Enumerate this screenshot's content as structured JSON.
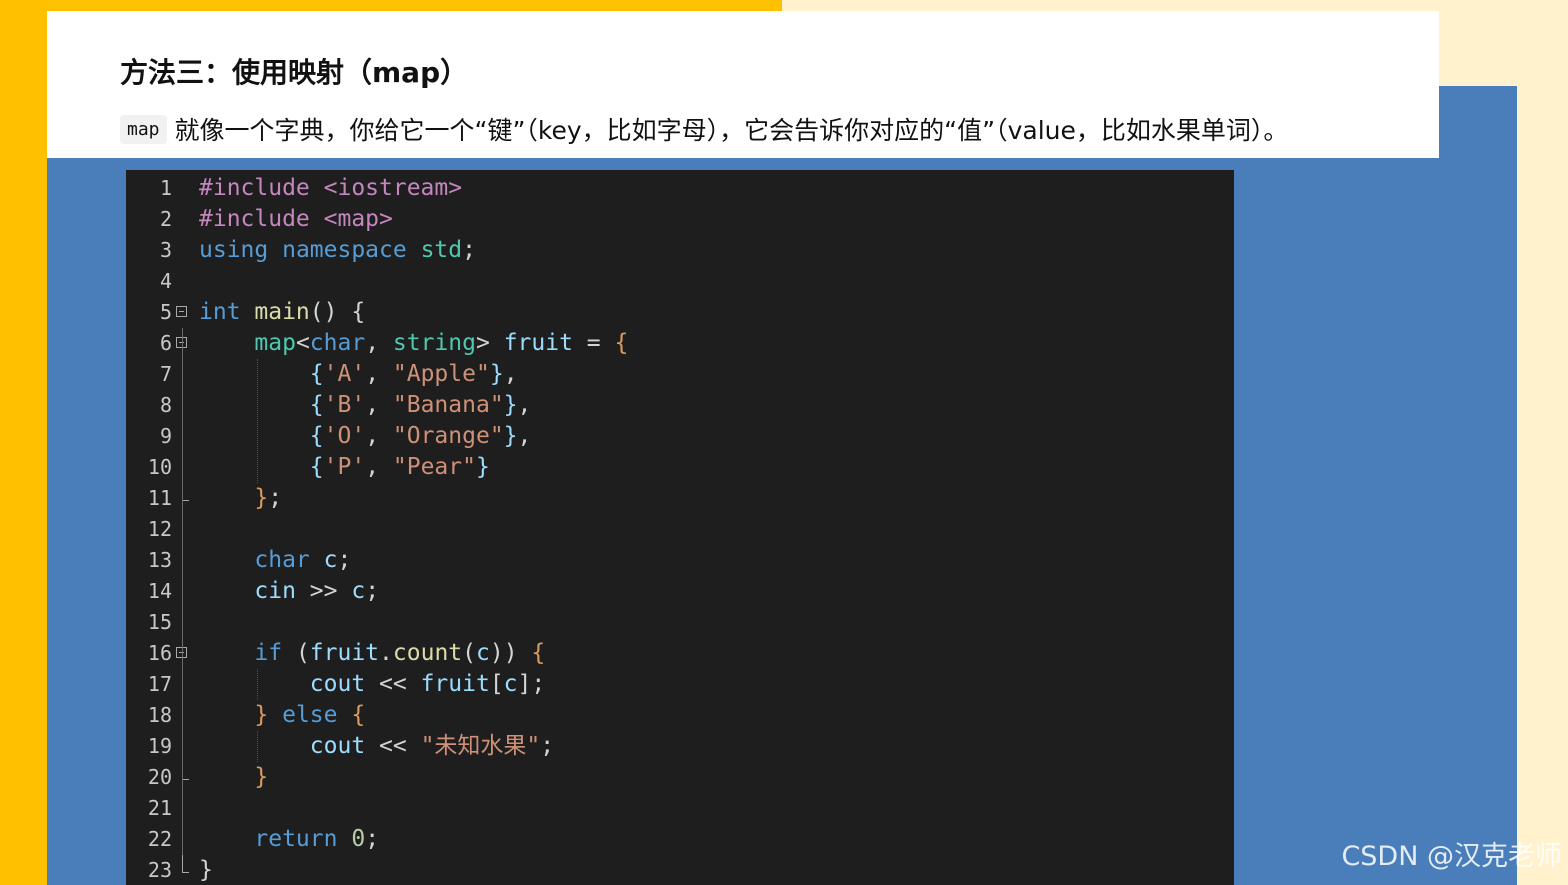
{
  "slide": {
    "heading": "方法三：使用映射（map）",
    "inline_code": "map",
    "description": "就像一个字典，你给它一个“键”（key，比如字母），它会告诉你对应的“值”（value，比如水果单词）。"
  },
  "code": {
    "language": "cpp",
    "lines": [
      {
        "n": "1",
        "fold": "",
        "tokens": [
          [
            "dir",
            "#include <iostream>"
          ]
        ]
      },
      {
        "n": "2",
        "fold": "",
        "tokens": [
          [
            "dir",
            "#include <map>"
          ]
        ]
      },
      {
        "n": "3",
        "fold": "",
        "tokens": [
          [
            "kw",
            "using "
          ],
          [
            "kw",
            "namespace "
          ],
          [
            "type",
            "std"
          ],
          [
            "pun",
            ";"
          ]
        ]
      },
      {
        "n": "4",
        "fold": "",
        "tokens": []
      },
      {
        "n": "5",
        "fold": "open",
        "tokens": [
          [
            "kw",
            "int "
          ],
          [
            "fn",
            "main"
          ],
          [
            "pun",
            "() "
          ],
          [
            "pun",
            "{"
          ]
        ]
      },
      {
        "n": "6",
        "fold": "open",
        "tokens": [
          [
            "pun",
            "    "
          ],
          [
            "type",
            "map"
          ],
          [
            "pun",
            "<"
          ],
          [
            "kw",
            "char"
          ],
          [
            "pun",
            ", "
          ],
          [
            "type",
            "string"
          ],
          [
            "pun",
            "> "
          ],
          [
            "var",
            "fruit"
          ],
          [
            "pun",
            " = "
          ],
          [
            "brc",
            "{"
          ]
        ]
      },
      {
        "n": "7",
        "fold": "",
        "tokens": [
          [
            "pun",
            "        "
          ],
          [
            "var",
            "{"
          ],
          [
            "str",
            "'A'"
          ],
          [
            "pun",
            ", "
          ],
          [
            "str",
            "\"Apple\""
          ],
          [
            "var",
            "}"
          ],
          [
            "pun",
            ","
          ]
        ]
      },
      {
        "n": "8",
        "fold": "",
        "tokens": [
          [
            "pun",
            "        "
          ],
          [
            "var",
            "{"
          ],
          [
            "str",
            "'B'"
          ],
          [
            "pun",
            ", "
          ],
          [
            "str",
            "\"Banana\""
          ],
          [
            "var",
            "}"
          ],
          [
            "pun",
            ","
          ]
        ]
      },
      {
        "n": "9",
        "fold": "",
        "tokens": [
          [
            "pun",
            "        "
          ],
          [
            "var",
            "{"
          ],
          [
            "str",
            "'O'"
          ],
          [
            "pun",
            ", "
          ],
          [
            "str",
            "\"Orange\""
          ],
          [
            "var",
            "}"
          ],
          [
            "pun",
            ","
          ]
        ]
      },
      {
        "n": "10",
        "fold": "",
        "tokens": [
          [
            "pun",
            "        "
          ],
          [
            "var",
            "{"
          ],
          [
            "str",
            "'P'"
          ],
          [
            "pun",
            ", "
          ],
          [
            "str",
            "\"Pear\""
          ],
          [
            "var",
            "}"
          ]
        ]
      },
      {
        "n": "11",
        "fold": "end",
        "tokens": [
          [
            "pun",
            "    "
          ],
          [
            "brc",
            "}"
          ],
          [
            "pun",
            ";"
          ]
        ]
      },
      {
        "n": "12",
        "fold": "",
        "tokens": []
      },
      {
        "n": "13",
        "fold": "",
        "tokens": [
          [
            "pun",
            "    "
          ],
          [
            "kw",
            "char "
          ],
          [
            "var",
            "c"
          ],
          [
            "pun",
            ";"
          ]
        ]
      },
      {
        "n": "14",
        "fold": "",
        "tokens": [
          [
            "pun",
            "    "
          ],
          [
            "var",
            "cin"
          ],
          [
            "pun",
            " >> "
          ],
          [
            "var",
            "c"
          ],
          [
            "pun",
            ";"
          ]
        ]
      },
      {
        "n": "15",
        "fold": "",
        "tokens": []
      },
      {
        "n": "16",
        "fold": "open",
        "tokens": [
          [
            "pun",
            "    "
          ],
          [
            "kw",
            "if "
          ],
          [
            "pun",
            "("
          ],
          [
            "var",
            "fruit"
          ],
          [
            "pun",
            "."
          ],
          [
            "fn",
            "count"
          ],
          [
            "pun",
            "("
          ],
          [
            "var",
            "c"
          ],
          [
            "pun",
            ")) "
          ],
          [
            "brc",
            "{"
          ]
        ]
      },
      {
        "n": "17",
        "fold": "",
        "tokens": [
          [
            "pun",
            "        "
          ],
          [
            "var",
            "cout"
          ],
          [
            "pun",
            " << "
          ],
          [
            "var",
            "fruit"
          ],
          [
            "pun",
            "["
          ],
          [
            "var",
            "c"
          ],
          [
            "pun",
            "];"
          ]
        ]
      },
      {
        "n": "18",
        "fold": "",
        "tokens": [
          [
            "pun",
            "    "
          ],
          [
            "brc",
            "} "
          ],
          [
            "kw",
            "else "
          ],
          [
            "brc",
            "{"
          ]
        ]
      },
      {
        "n": "19",
        "fold": "",
        "tokens": [
          [
            "pun",
            "        "
          ],
          [
            "var",
            "cout"
          ],
          [
            "pun",
            " << "
          ],
          [
            "str",
            "\"未知水果\""
          ],
          [
            "pun",
            ";"
          ]
        ]
      },
      {
        "n": "20",
        "fold": "end",
        "tokens": [
          [
            "pun",
            "    "
          ],
          [
            "brc",
            "}"
          ]
        ]
      },
      {
        "n": "21",
        "fold": "",
        "tokens": []
      },
      {
        "n": "22",
        "fold": "",
        "tokens": [
          [
            "pun",
            "    "
          ],
          [
            "kw",
            "return "
          ],
          [
            "num",
            "0"
          ],
          [
            "pun",
            ";"
          ]
        ]
      },
      {
        "n": "23",
        "fold": "end",
        "tokens": [
          [
            "pun",
            "}"
          ]
        ]
      }
    ]
  },
  "watermark": "CSDN @汉克老师",
  "colors": {
    "accent_yellow": "#ffc000",
    "background_cream": "#fff2cc",
    "panel_blue": "#4a7ebb",
    "editor_bg": "#1e1e1e"
  }
}
